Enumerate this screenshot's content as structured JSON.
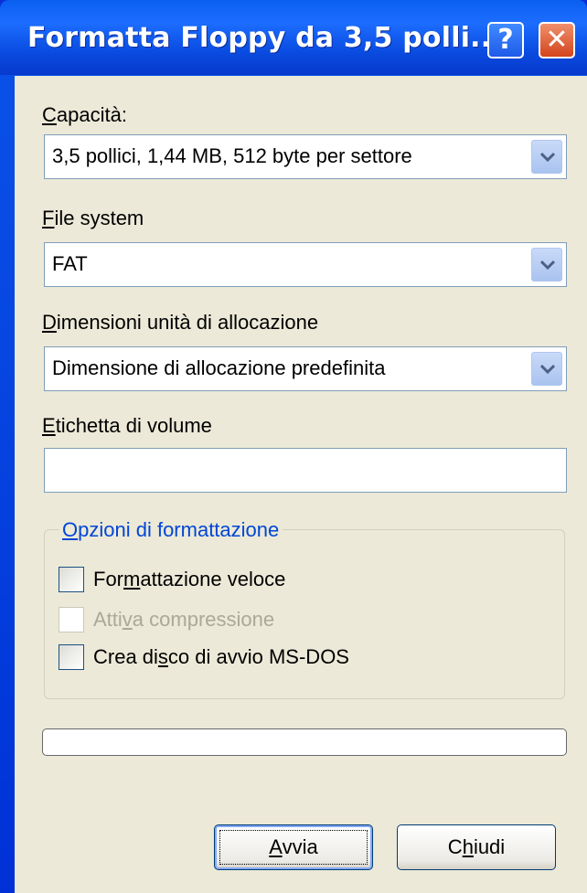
{
  "window": {
    "title": "Formatta Floppy da 3,5 polli...",
    "help_icon": "?",
    "close_icon": "✕"
  },
  "capacity": {
    "label_access": "C",
    "label_rest": "apacità:",
    "value": "3,5 pollici, 1,44 MB, 512 byte per settore"
  },
  "file_system": {
    "label_access": "F",
    "label_rest": "ile system",
    "value": "FAT"
  },
  "allocation": {
    "label_access": "D",
    "label_rest": "imensioni unità di allocazione",
    "value": "Dimensione di allocazione predefinita"
  },
  "volume_label": {
    "label_access": "E",
    "label_rest": "tichetta di volume",
    "value": ""
  },
  "options": {
    "title_access": "O",
    "title_rest": "pzioni di formattazione",
    "quick_format": {
      "pre": "For",
      "access": "m",
      "post": "attazione veloce",
      "checked": false,
      "enabled": true
    },
    "compression": {
      "pre": "Atti",
      "access": "v",
      "post": "a compressione",
      "checked": false,
      "enabled": false
    },
    "boot_disk": {
      "pre": "Crea di",
      "access": "s",
      "post": "co di avvio MS-DOS",
      "checked": false,
      "enabled": true
    }
  },
  "progress": {
    "value": 0
  },
  "buttons": {
    "start": {
      "access": "A",
      "rest": "vvia"
    },
    "close": {
      "pre": "C",
      "access": "h",
      "rest": "iudi"
    }
  },
  "colors": {
    "titlebar": "#0a54e8",
    "client": "#ece9d8",
    "group_title": "#0046d5",
    "close_button": "#d3451c"
  }
}
